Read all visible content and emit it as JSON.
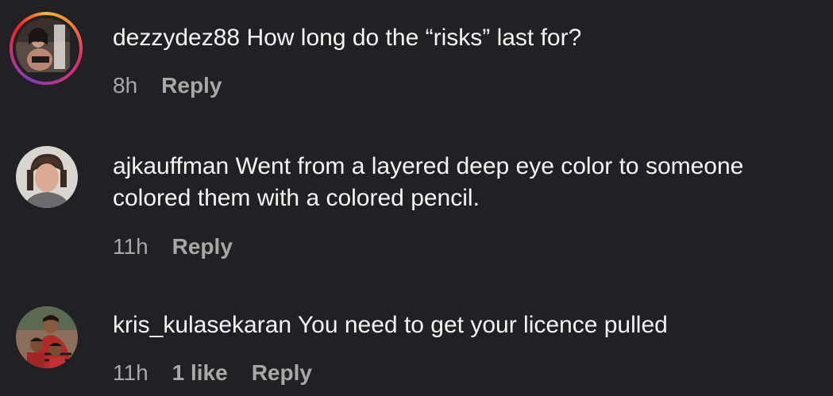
{
  "comments": [
    {
      "username": "dezzydez88",
      "text": "How long do the “risks” last for?",
      "time": "8h",
      "likes": "",
      "reply_label": "Reply",
      "has_story_ring": true
    },
    {
      "username": "ajkauffman",
      "text": "Went from a layered deep eye color to someone colored them with a colored pencil.",
      "time": "11h",
      "likes": "",
      "reply_label": "Reply",
      "has_story_ring": false
    },
    {
      "username": "kris_kulasekaran",
      "text": "You need to get your licence pulled",
      "time": "11h",
      "likes": "1 like",
      "reply_label": "Reply",
      "has_story_ring": false
    }
  ],
  "colors": {
    "background": "#212125",
    "text": "#f5f5f5",
    "meta": "#a8a8a8"
  }
}
